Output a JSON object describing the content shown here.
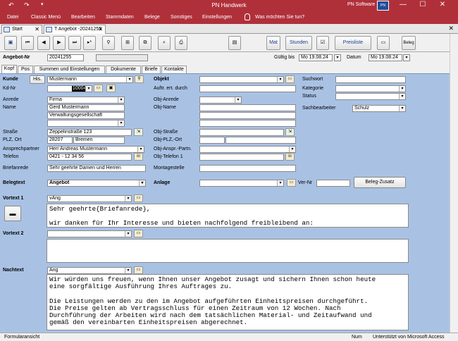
{
  "titlebar": {
    "title": "PN Handwerk",
    "brand": "PN Software",
    "logo_text": "PN soft",
    "min": "—",
    "max": "☐",
    "close": "✕",
    "undo": "↶",
    "redo": "↷",
    "qat": "▾"
  },
  "menu": [
    "Datei",
    "Classic Menü",
    "Bearbeiten",
    "Stammdaten",
    "Belege",
    "Sonstiges",
    "Einstellungen",
    "Was möchten Sie tun?"
  ],
  "doctabs": {
    "start": "Start",
    "angebot": "T Angebot -20241255",
    "close": "✕"
  },
  "toolbar": {
    "mat": "Mat",
    "stunden": "Stunden",
    "preisliste": "Preisliste",
    "beleg": "Beleg"
  },
  "header": {
    "angebot_label": "Angebot-Nr",
    "angebot_value": "20241255",
    "gueltig_label": "Gültig bis",
    "gueltig_value": "Mo 19.08.24",
    "datum_label": "Datum",
    "datum_value": "Mo 19.08.24"
  },
  "formtabs": [
    "Kopf",
    "Pos",
    "Summen und Einstellungen",
    "Dokumente",
    "Briefe",
    "Kontakte"
  ],
  "left": {
    "kunde_label": "Kunde",
    "his_button": "His.",
    "kunde_value": "Mustermann",
    "kdnr_label": "Kd-Nr",
    "kdnr_value": "10004",
    "anrede_label": "Anrede",
    "anrede_value": "Firma",
    "name_label": "Name",
    "name1": "Gerd Mustermann",
    "name2": "Verwaltungsgesellschaft",
    "strasse_label": "Straße",
    "strasse_value": "Zeppelinstraße 123",
    "plz_label": "PLZ, Ort",
    "plz_value": "28207",
    "ort_value": "Bremen",
    "ansprech_label": "Ansprechpartner",
    "ansprech_value": "Herr Andreas Mustermann",
    "telefon_label": "Telefon",
    "telefon_value": "0421 - 12 34 56",
    "briefanrede_label": "Briefanrede",
    "briefanrede_value": "Sehr geehrte Damen und Herren"
  },
  "middle": {
    "objekt_label": "Objekt",
    "auftr_label": "Auftr. ert. durch",
    "objanrede_label": "Obj-Anrede",
    "objname_label": "Obj-Name",
    "objstrasse_label": "Obj-Straße",
    "objplz_label": "Obj-PLZ,-Ort",
    "objansp_label": "Obj-Anspr.-Partn.",
    "objtel_label": "Obj-Telefon 1",
    "montage_label": "Montagestelle"
  },
  "right": {
    "suchwort_label": "Suchwort",
    "kategorie_label": "Kategorie",
    "status_label": "Status",
    "sachb_label": "Sachbearbeiter",
    "sachb_value": "Schulz"
  },
  "belegtext": {
    "label": "Belegtext",
    "value": "Angebot",
    "anlage_label": "Anlage",
    "vernr_label": "Ver-Nr",
    "zusatz_button": "Beleg-Zusatz"
  },
  "vortext1": {
    "label": "Vortext 1",
    "value": "vAng",
    "text": "Sehr geehrte{Briefanrede},\n\nwir danken für Ihr Interesse und bieten nachfolgend freibleibend an:"
  },
  "vortext2": {
    "label": "Vortext 2"
  },
  "nachtext": {
    "label": "Nachtext",
    "value": "Ang",
    "text": "Wir würden uns freuen, wenn Ihnen unser Angebot zusagt und sichern Ihnen schon heute\neine sorgfältige Ausführung Ihres Auftrages zu.\n\nDie Leistungen werden zu den im Angebot aufgeführten Einheitspreisen durchgeführt.\nDie Preise gelten ab Vertragsschluss für einen Zeitraum von 12 Wochen. Nach\nDurchführung der Arbeiten wird nach dem tatsächlichen Material- und Zeitaufwand und\ngemäß den vereinbarten Einheitspreisen abgerechnet."
  },
  "statusbar": {
    "left": "Formularansicht",
    "num": "Num",
    "access": "Unterstützt von Microsoft Access"
  }
}
